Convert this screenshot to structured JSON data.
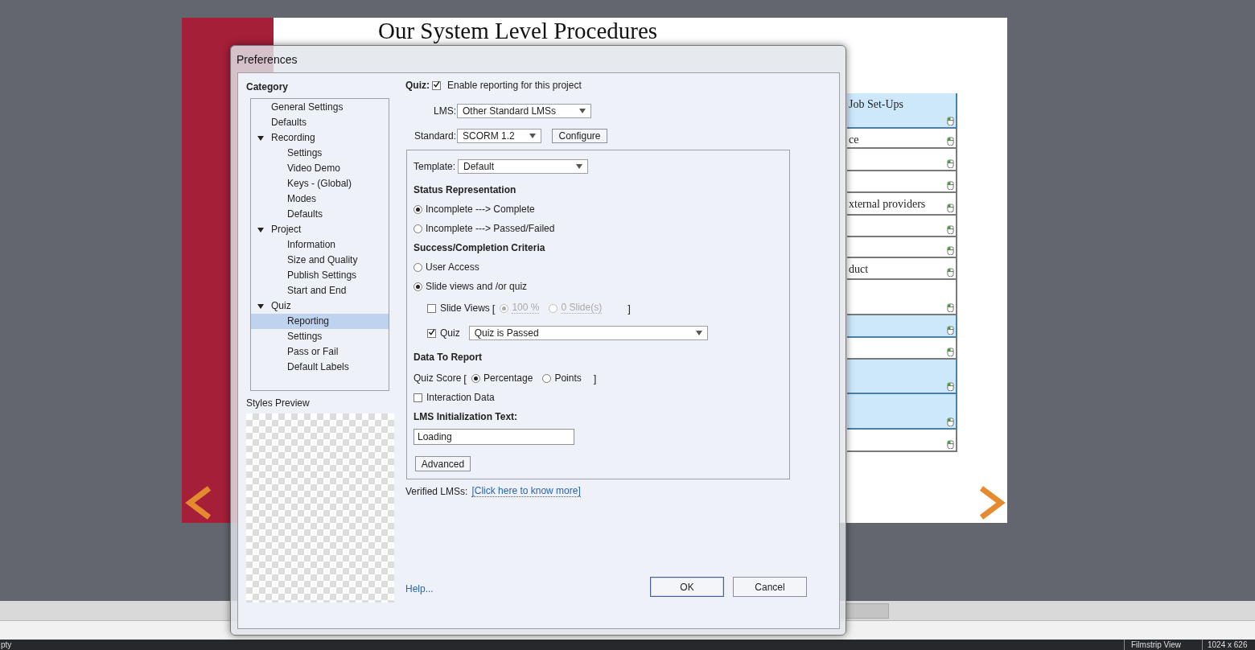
{
  "window": {
    "title": "Preferences"
  },
  "background": {
    "slide_title": "Our System Level Procedures",
    "table_rows": [
      {
        "text": "Job Set-Ups",
        "highlighted": true
      },
      {
        "text": "ce",
        "highlighted": false
      },
      {
        "text": "",
        "highlighted": false
      },
      {
        "text": "",
        "highlighted": false
      },
      {
        "text": "xternal providers",
        "highlighted": false
      },
      {
        "text": "",
        "highlighted": false
      },
      {
        "text": "",
        "highlighted": false
      },
      {
        "text": "duct",
        "highlighted": false
      },
      {
        "text": "",
        "highlighted": false
      },
      {
        "text": "",
        "highlighted": true
      },
      {
        "text": "",
        "highlighted": false
      },
      {
        "text": "",
        "highlighted": true
      },
      {
        "text": "",
        "highlighted": true
      },
      {
        "text": "",
        "highlighted": false
      }
    ],
    "status_bar": {
      "left": "pty",
      "view": "Filmstrip View",
      "size": "1024 x 626"
    }
  },
  "category": {
    "heading": "Category",
    "tree": [
      {
        "label": "General Settings",
        "selected": false
      },
      {
        "label": "Defaults",
        "selected": false
      },
      {
        "label": "Recording",
        "selected": false,
        "expanded": true,
        "children": [
          {
            "label": "Settings",
            "selected": false
          },
          {
            "label": "Video Demo",
            "selected": false
          },
          {
            "label": "Keys - (Global)",
            "selected": false
          },
          {
            "label": "Modes",
            "selected": false
          },
          {
            "label": "Defaults",
            "selected": false
          }
        ]
      },
      {
        "label": "Project",
        "selected": false,
        "expanded": true,
        "children": [
          {
            "label": "Information",
            "selected": false
          },
          {
            "label": "Size and Quality",
            "selected": false
          },
          {
            "label": "Publish Settings",
            "selected": false
          },
          {
            "label": "Start and End",
            "selected": false
          }
        ]
      },
      {
        "label": "Quiz",
        "selected": false,
        "expanded": true,
        "children": [
          {
            "label": "Reporting",
            "selected": true
          },
          {
            "label": "Settings",
            "selected": false
          },
          {
            "label": "Pass or Fail",
            "selected": false
          },
          {
            "label": "Default Labels",
            "selected": false
          }
        ]
      }
    ]
  },
  "styles_preview": {
    "label": "Styles Preview"
  },
  "quiz": {
    "label": "Quiz:",
    "enable": {
      "label": "Enable reporting for this project",
      "checked": true
    },
    "lms": {
      "label": "LMS:",
      "value": "Other Standard LMSs"
    },
    "standard": {
      "label": "Standard:",
      "value": "SCORM 1.2"
    },
    "configure": "Configure",
    "template": {
      "label": "Template:",
      "value": "Default"
    },
    "status_representation": {
      "heading": "Status Representation",
      "options": [
        {
          "label": "Incomplete ---> Complete",
          "selected": true
        },
        {
          "label": "Incomplete ---> Passed/Failed",
          "selected": false
        }
      ]
    },
    "criteria": {
      "heading": "Success/Completion Criteria",
      "options": [
        {
          "label": "User Access",
          "selected": false
        },
        {
          "label": "Slide views and /or quiz",
          "selected": true
        }
      ]
    },
    "slide_views": {
      "label": "Slide Views",
      "checked": false,
      "open": "[",
      "close": "]",
      "options": [
        {
          "label": "100 %",
          "selected": true,
          "disabled": true
        },
        {
          "label": "0 Slide(s)",
          "selected": false,
          "disabled": true
        }
      ]
    },
    "quiz_criterion": {
      "label": "Quiz",
      "checked": true,
      "value": "Quiz is Passed"
    },
    "data_to_report": {
      "heading": "Data To Report",
      "quiz_score": {
        "label": "Quiz Score",
        "open": "[",
        "close": "]",
        "options": [
          {
            "label": "Percentage",
            "selected": true
          },
          {
            "label": "Points",
            "selected": false
          }
        ]
      },
      "interaction": {
        "label": "Interaction Data",
        "checked": false
      }
    },
    "init_text": {
      "heading": "LMS Initialization Text:",
      "value": "Loading"
    },
    "advanced": "Advanced",
    "verified": {
      "label": "Verified LMSs:",
      "link": "[Click here to know more]"
    }
  },
  "help": "Help...",
  "buttons": [
    {
      "label": "OK",
      "default": true
    },
    {
      "label": "Cancel",
      "default": false
    }
  ]
}
